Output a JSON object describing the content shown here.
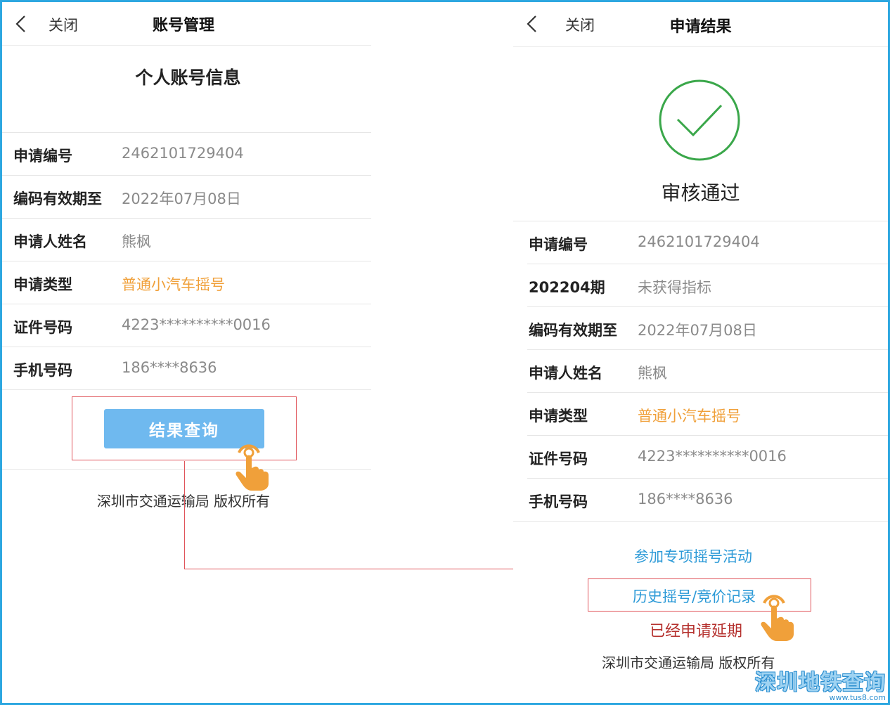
{
  "left": {
    "nav": {
      "close_label": "关闭",
      "title": "账号管理"
    },
    "section_title": "个人账号信息",
    "rows": [
      {
        "label": "申请编号",
        "value": "2462101729404",
        "highlight": false
      },
      {
        "label": "编码有效期至",
        "value": "2022年07月08日",
        "highlight": false
      },
      {
        "label": "申请人姓名",
        "value": "熊枫",
        "highlight": false
      },
      {
        "label": "申请类型",
        "value": "普通小汽车摇号",
        "highlight": true
      },
      {
        "label": "证件号码",
        "value": "4223**********0016",
        "highlight": false
      },
      {
        "label": "手机号码",
        "value": "186****8636",
        "highlight": false
      }
    ],
    "query_button": "结果查询",
    "footer": "深圳市交通运输局 版权所有"
  },
  "right": {
    "nav": {
      "close_label": "关闭",
      "title": "申请结果"
    },
    "status_title": "审核通过",
    "rows": [
      {
        "label": "申请编号",
        "value": "2462101729404",
        "highlight": false
      },
      {
        "label": "202204期",
        "value": "未获得指标",
        "highlight": false
      },
      {
        "label": "编码有效期至",
        "value": "2022年07月08日",
        "highlight": false
      },
      {
        "label": "申请人姓名",
        "value": "熊枫",
        "highlight": false
      },
      {
        "label": "申请类型",
        "value": "普通小汽车摇号",
        "highlight": true
      },
      {
        "label": "证件号码",
        "value": "4223**********0016",
        "highlight": false
      },
      {
        "label": "手机号码",
        "value": "186****8636",
        "highlight": false
      }
    ],
    "special_link": "参加专项摇号活动",
    "history_link": "历史摇号/竞价记录",
    "status_note": "已经申请延期",
    "footer": "深圳市交通运输局 版权所有"
  },
  "watermark": {
    "main": "深圳地铁查询",
    "url": "www.tus8.com"
  },
  "colors": {
    "accent_orange": "#f0a03a",
    "button_blue": "#6fb9ef",
    "link_blue": "#2c9ad7",
    "success_green": "#3aa74a",
    "annotation_red": "#e0545a",
    "note_red": "#b5312e",
    "frame_blue": "#2da7e0"
  },
  "icons": [
    "back-chevron-icon",
    "check-circle-icon",
    "pointing-hand-icon"
  ]
}
